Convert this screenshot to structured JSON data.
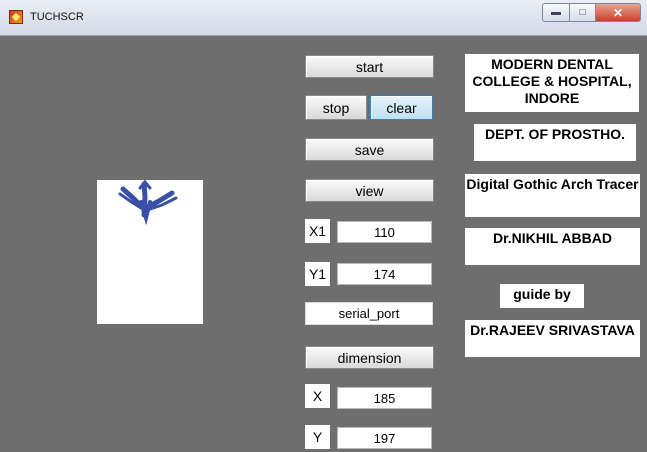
{
  "window": {
    "title": "TUCHSCR",
    "icons": {
      "app": "matlab-figure-icon",
      "minimize": "minimize-icon",
      "maximize": "maximize-icon",
      "close": "close-icon"
    }
  },
  "buttons": {
    "start": "start",
    "stop": "stop",
    "clear": "clear",
    "save": "save",
    "view": "view",
    "dimension": "dimension"
  },
  "readouts": {
    "x1_label": "X1",
    "x1_value": "110",
    "y1_label": "Y1",
    "y1_value": "174",
    "serial_port": "serial_port",
    "x_label": "X",
    "x_value": "185",
    "y_label": "Y",
    "y_value": "197"
  },
  "info": {
    "college": "MODERN DENTAL COLLEGE & HOSPITAL, INDORE",
    "dept": "DEPT. OF PROSTHO.",
    "project": "Digital Gothic Arch Tracer",
    "author": "Dr.NIKHIL ABBAD",
    "guide_label": "guide by",
    "guide_name": "Dr.RAJEEV SRIVASTAVA"
  },
  "colors": {
    "background": "#6e6e6e",
    "trace": "#3a4fa8",
    "active_button": "#bfe0f2"
  }
}
